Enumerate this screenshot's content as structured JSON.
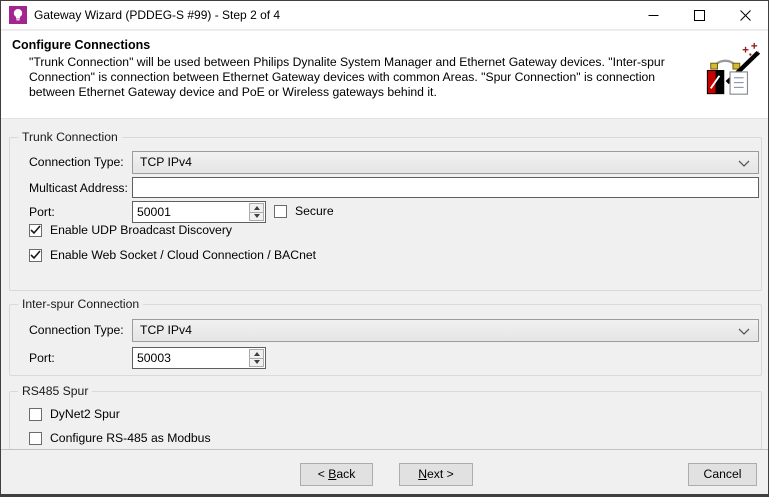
{
  "window": {
    "title": "Gateway Wizard (PDDEG-S #99) - Step 2 of 4"
  },
  "header": {
    "title": "Configure Connections",
    "description": "\"Trunk Connection\" will be used between Philips Dynalite System Manager and Ethernet Gateway devices. \"Inter-spur Connection\" is connection between Ethernet Gateway devices with common Areas. \"Spur Connection\" is connection between Ethernet Gateway device and PoE or Wireless gateways behind it."
  },
  "trunk": {
    "group_label": "Trunk Connection",
    "connection_type_label": "Connection Type:",
    "connection_type_value": "TCP IPv4",
    "multicast_label": "Multicast Address:",
    "multicast_value": "",
    "port_label": "Port:",
    "port_value": "50001",
    "secure_label": "Secure",
    "secure_checked": false,
    "udp_label": "Enable UDP Broadcast Discovery",
    "udp_checked": true,
    "websocket_label": "Enable Web Socket / Cloud Connection / BACnet",
    "websocket_checked": true
  },
  "interspur": {
    "group_label": "Inter-spur Connection",
    "connection_type_label": "Connection Type:",
    "connection_type_value": "TCP IPv4",
    "port_label": "Port:",
    "port_value": "50003"
  },
  "rs485": {
    "group_label": "RS485 Spur",
    "dynet2_label": "DyNet2 Spur",
    "dynet2_checked": false,
    "modbus_label": "Configure RS-485 as Modbus",
    "modbus_checked": false
  },
  "footer": {
    "back": {
      "pre": "< ",
      "accel": "B",
      "post": "ack"
    },
    "next": {
      "pre": "",
      "accel": "N",
      "post": "ext >"
    },
    "cancel": "Cancel"
  },
  "colors": {
    "brand_purple": "#A3268E",
    "sparkle_red": "#8B2020",
    "dialog_gray": "#F0F0F0"
  }
}
